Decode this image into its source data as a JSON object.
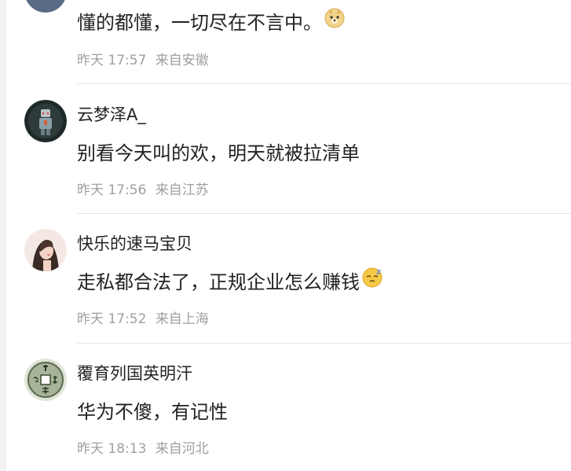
{
  "comments": [
    {
      "username": "",
      "content": "懂的都懂，一切尽在不言中。",
      "emoji": "doge-emoji",
      "time": "昨天 17:57",
      "location": "来自安徽"
    },
    {
      "username": "云梦泽A_",
      "content": "别看今天叫的欢，明天就被拉清单",
      "time": "昨天 17:56",
      "location": "来自江苏"
    },
    {
      "username": "快乐的速马宝贝",
      "content": "走私都合法了，正规企业怎么赚钱",
      "emoji": "sleepy-face-emoji",
      "time": "昨天 17:52",
      "location": "来自上海"
    },
    {
      "username": "覆育列国英明汗",
      "content": "华为不傻，有记性",
      "time": "昨天 18:13",
      "location": "来自河北"
    }
  ]
}
